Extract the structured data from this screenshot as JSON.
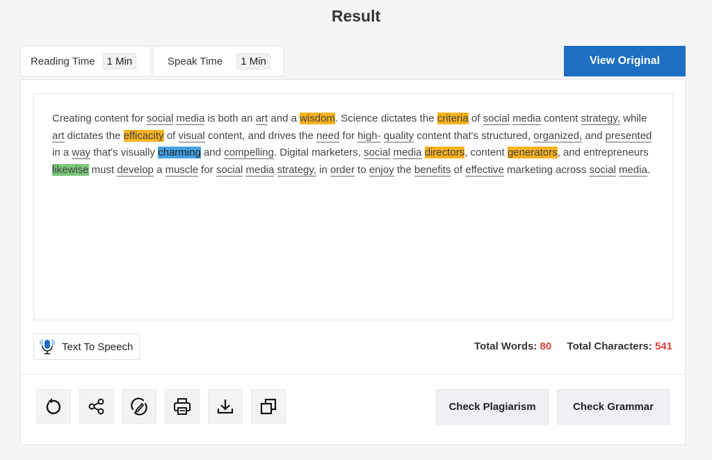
{
  "page": {
    "title": "Result"
  },
  "stats": {
    "reading_label": "Reading Time",
    "reading_value": "1 Min",
    "speak_label": "Speak Time",
    "speak_value": "1 Min"
  },
  "view_original_label": "View Original",
  "result_text": [
    {
      "t": "Creating content for "
    },
    {
      "t": "social",
      "s": "u"
    },
    {
      "t": " "
    },
    {
      "t": "media",
      "s": "u"
    },
    {
      "t": " is both an "
    },
    {
      "t": "art",
      "s": "u"
    },
    {
      "t": " and a "
    },
    {
      "t": "wisdom",
      "s": "orange"
    },
    {
      "t": ". Science dictates the "
    },
    {
      "t": "criteria",
      "s": "orange"
    },
    {
      "t": " of "
    },
    {
      "t": "social",
      "s": "u"
    },
    {
      "t": " "
    },
    {
      "t": "media",
      "s": "u"
    },
    {
      "t": " content "
    },
    {
      "t": "strategy,",
      "s": "u"
    },
    {
      "t": " while "
    },
    {
      "t": "art",
      "s": "u"
    },
    {
      "t": " dictates the "
    },
    {
      "t": "efficacity",
      "s": "orange"
    },
    {
      "t": " of "
    },
    {
      "t": "visual",
      "s": "u"
    },
    {
      "t": " content, and drives the "
    },
    {
      "t": "need",
      "s": "u"
    },
    {
      "t": " for "
    },
    {
      "t": "high-",
      "s": "u"
    },
    {
      "t": " "
    },
    {
      "t": "quality",
      "s": "u"
    },
    {
      "t": " content that's structured, "
    },
    {
      "t": "organized,",
      "s": "u"
    },
    {
      "t": " and "
    },
    {
      "t": "presented",
      "s": "u"
    },
    {
      "t": " in a "
    },
    {
      "t": "way",
      "s": "u"
    },
    {
      "t": " that's visually "
    },
    {
      "t": "charming",
      "s": "blue"
    },
    {
      "t": " and "
    },
    {
      "t": "compelling",
      "s": "u"
    },
    {
      "t": ". Digital marketers, "
    },
    {
      "t": "social",
      "s": "u"
    },
    {
      "t": " "
    },
    {
      "t": "media",
      "s": "u"
    },
    {
      "t": " "
    },
    {
      "t": "directors",
      "s": "orange"
    },
    {
      "t": ", content "
    },
    {
      "t": "generators",
      "s": "orange"
    },
    {
      "t": ", and entrepreneurs "
    },
    {
      "t": "likewise",
      "s": "green"
    },
    {
      "t": " must "
    },
    {
      "t": "develop",
      "s": "u"
    },
    {
      "t": " a "
    },
    {
      "t": "muscle",
      "s": "u"
    },
    {
      "t": " for "
    },
    {
      "t": "social",
      "s": "u"
    },
    {
      "t": " "
    },
    {
      "t": "media",
      "s": "u"
    },
    {
      "t": " "
    },
    {
      "t": "strategy,",
      "s": "u"
    },
    {
      "t": " in "
    },
    {
      "t": "order",
      "s": "u"
    },
    {
      "t": " to "
    },
    {
      "t": "enjoy",
      "s": "u"
    },
    {
      "t": " the "
    },
    {
      "t": "benefits",
      "s": "u"
    },
    {
      "t": " of "
    },
    {
      "t": "effective",
      "s": "u"
    },
    {
      "t": " marketing across "
    },
    {
      "t": "social",
      "s": "u"
    },
    {
      "t": " "
    },
    {
      "t": "media",
      "s": "u"
    },
    {
      "t": "."
    }
  ],
  "tts_label": "Text To Speech",
  "counts": {
    "words_label": "Total Words:",
    "words_value": "80",
    "chars_label": "Total Characters:",
    "chars_value": "541"
  },
  "actions": {
    "plagiarism_label": "Check Plagiarism",
    "grammar_label": "Check Grammar"
  },
  "icons": [
    "refresh-icon",
    "share-icon",
    "rewrite-icon",
    "print-icon",
    "download-icon",
    "copy-icon"
  ],
  "colors": {
    "accent": "#1d6fc3",
    "highlight_orange": "#f7b21f",
    "highlight_blue": "#44a1e6",
    "highlight_green": "#7ac67a",
    "count_red": "#e0403a"
  }
}
